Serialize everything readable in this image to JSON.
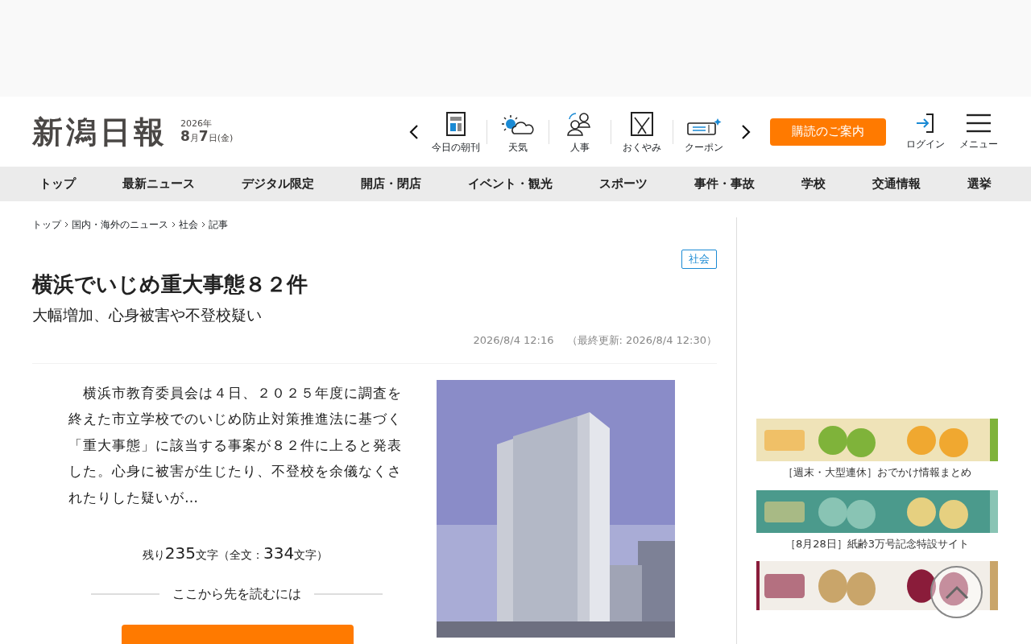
{
  "header": {
    "logo": "新潟日報",
    "date_year": "2026年",
    "date_month": "8",
    "date_month_unit": "月",
    "date_day": "7",
    "date_day_unit": "日",
    "date_weekday": "(金)",
    "shortcuts": [
      {
        "label": "今日の朝刊",
        "kind": "paper"
      },
      {
        "label": "天気",
        "kind": "weather"
      },
      {
        "label": "人事",
        "kind": "people"
      },
      {
        "label": "おくやみ",
        "kind": "condolence"
      },
      {
        "label": "クーポン",
        "kind": "coupon"
      }
    ],
    "subscribe": "購読のご案内",
    "login": "ログイン",
    "menu": "メニュー"
  },
  "nav": [
    "トップ",
    "最新ニュース",
    "デジタル限定",
    "開店・閉店",
    "イベント・観光",
    "スポーツ",
    "事件・事故",
    "学校",
    "交通情報",
    "選挙"
  ],
  "breadcrumb": [
    "トップ",
    "国内・海外のニュース",
    "社会",
    "記事"
  ],
  "article": {
    "category": "社会",
    "title": "横浜でいじめ重大事態８２件",
    "subtitle": "大幅増加、心身被害や不登校疑い",
    "published": "2026/8/4 12:16",
    "updated": "（最終更新: 2026/8/4 12:30）",
    "body": "　横浜市教育委員会は４日、２０２５年度に調査を終えた市立学校でのいじめ防止対策推進法に基づく「重大事態」に該当する事案が８２件に上ると発表した。心身に被害が生じたり、不登校を余儀なくされたりした疑いが…",
    "remaining_prefix": "残り",
    "remaining": "235",
    "remaining_unit": "文字",
    "total_prefix": "（全文：",
    "total": "334",
    "total_unit": "文字）",
    "read_more": "ここから先を読むには"
  },
  "sidebar": {
    "banners": [
      {
        "caption": "［週末・大型連休］おでかけ情報まとめ",
        "kind": "event"
      },
      {
        "caption": "［8月28日］紙齢3万号記念特設サイト",
        "kind": "anniversary"
      },
      {
        "kind": "award"
      }
    ]
  }
}
